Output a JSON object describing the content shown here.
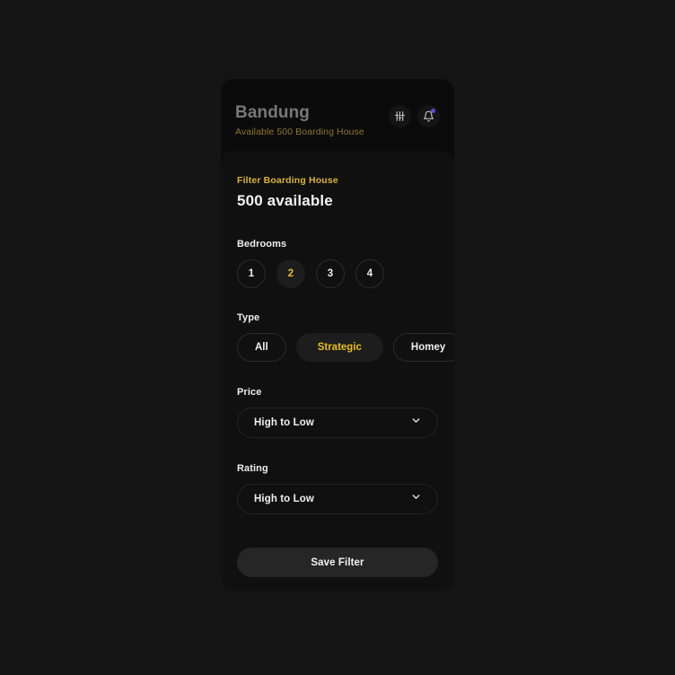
{
  "header": {
    "city": "Bandung",
    "subtitle": "Available 500 Boarding House",
    "sliders_icon": "sliders-icon",
    "bell_icon": "bell-icon",
    "notification_dot_color": "#6a46d8"
  },
  "filter": {
    "eyebrow": "Filter Boarding House",
    "count_label": "500 available",
    "bedrooms": {
      "label": "Bedrooms",
      "options": [
        "1",
        "2",
        "3",
        "4"
      ],
      "selected": "2"
    },
    "type": {
      "label": "Type",
      "options": [
        "All",
        "Strategic",
        "Homey"
      ],
      "selected": "Strategic"
    },
    "price": {
      "label": "Price",
      "value": "High to Low",
      "chevron_icon": "chevron-down-icon"
    },
    "rating": {
      "label": "Rating",
      "value": "High to Low",
      "chevron_icon": "chevron-down-icon"
    },
    "save_label": "Save Filter"
  },
  "colors": {
    "page_background": "#141414",
    "card_background": "#0b0b0b",
    "panel_background": "#101010",
    "accent_gold": "#e8bd1f",
    "accent_gold_dim": "#d8b433",
    "subtitle_olive": "#8a7430"
  }
}
